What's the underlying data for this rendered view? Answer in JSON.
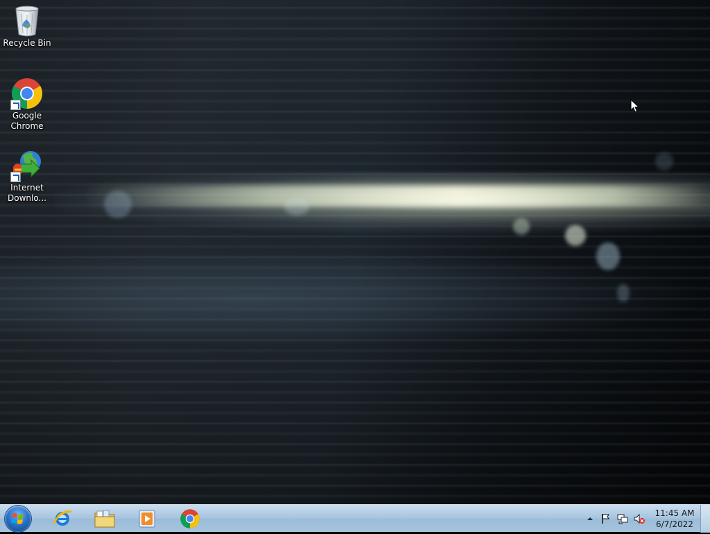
{
  "desktop": {
    "icons": [
      {
        "label": "Recycle Bin",
        "icon": "recycle-bin-icon",
        "shortcut": false
      },
      {
        "label": "Google\nChrome",
        "icon": "chrome-icon",
        "shortcut": true
      },
      {
        "label": "Internet\nDownlo...",
        "icon": "internet-download-manager-icon",
        "shortcut": true
      }
    ]
  },
  "taskbar": {
    "start_icon": "windows-start-orb",
    "pinned": [
      {
        "app": "Internet Explorer",
        "icon": "internet-explorer-icon"
      },
      {
        "app": "Windows Explorer",
        "icon": "folder-libraries-icon"
      },
      {
        "app": "Windows Media Player",
        "icon": "media-player-icon"
      },
      {
        "app": "Google Chrome",
        "icon": "chrome-icon"
      }
    ],
    "tray": {
      "icons": [
        "show-hidden-icons-chevron",
        "action-center-flag-icon",
        "network-icon",
        "volume-muted-icon"
      ],
      "time": "11:45 AM",
      "date": "6/7/2022"
    }
  },
  "colors": {
    "taskbar_top": "#c9ddef",
    "taskbar_bottom": "#9bbcd9",
    "clock_text": "#1a1a1a",
    "icon_label": "#ffffff"
  }
}
